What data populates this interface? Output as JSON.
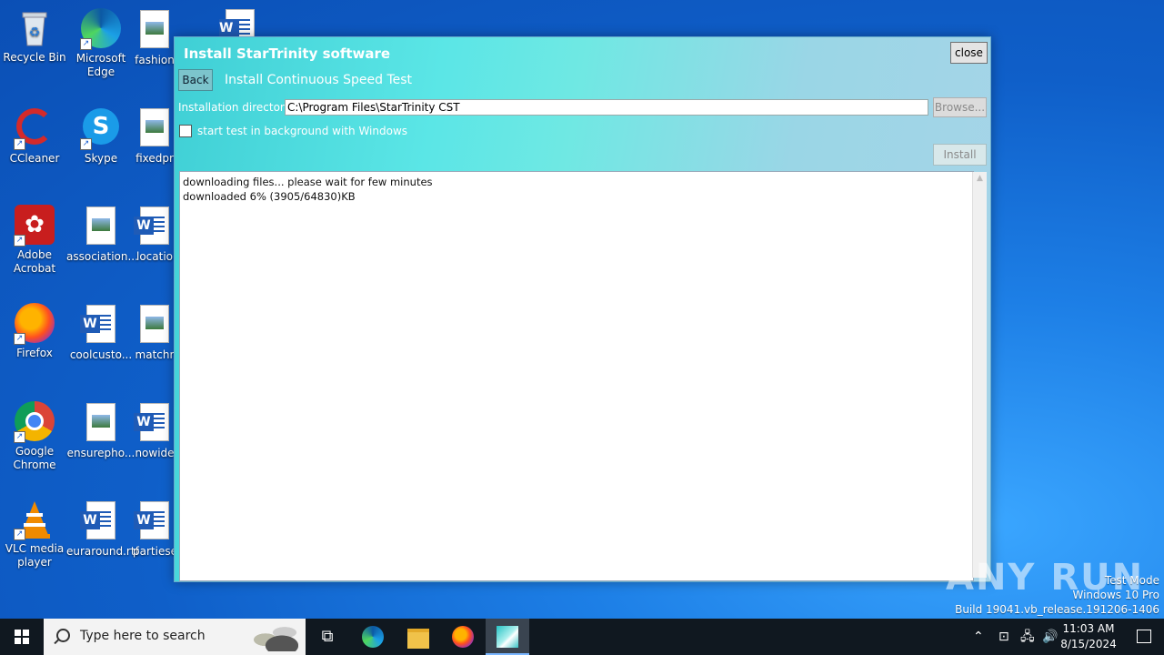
{
  "desktop": {
    "icons": [
      {
        "label": "Recycle Bin"
      },
      {
        "label": "Microsoft Edge"
      },
      {
        "label": "fashion"
      },
      {
        "label": "CCleaner"
      },
      {
        "label": "Skype"
      },
      {
        "label": "fixedpr"
      },
      {
        "label": "Adobe Acrobat"
      },
      {
        "label": "association..."
      },
      {
        "label": "locatio"
      },
      {
        "label": "Firefox"
      },
      {
        "label": "coolcusto..."
      },
      {
        "label": "matchr"
      },
      {
        "label": "Google Chrome"
      },
      {
        "label": "ensurepho..."
      },
      {
        "label": "nowide"
      },
      {
        "label": "VLC media player"
      },
      {
        "label": "euraround.rtf"
      },
      {
        "label": "partiese"
      }
    ]
  },
  "window": {
    "title": "Install StarTrinity software",
    "close_label": "close",
    "back_label": "Back",
    "subtitle": "Install Continuous Speed Test",
    "dir_label": "Installation directory:",
    "dir_value": "C:\\Program Files\\StarTrinity CST",
    "browse_label": "Browse...",
    "checkbox_label": "start test in background with Windows",
    "checkbox_checked": false,
    "install_label": "Install",
    "log_lines": [
      "downloading files... please wait for few minutes",
      "downloaded 6% (3905/64830)KB"
    ]
  },
  "watermark": {
    "text": "ANY RUN"
  },
  "sysinfo": {
    "line1": "Test Mode",
    "line2": "Windows 10 Pro",
    "line3": "Build 19041.vb_release.191206-1406"
  },
  "taskbar": {
    "search_placeholder": "Type here to search",
    "time": "11:03 AM",
    "date": "8/15/2024"
  }
}
